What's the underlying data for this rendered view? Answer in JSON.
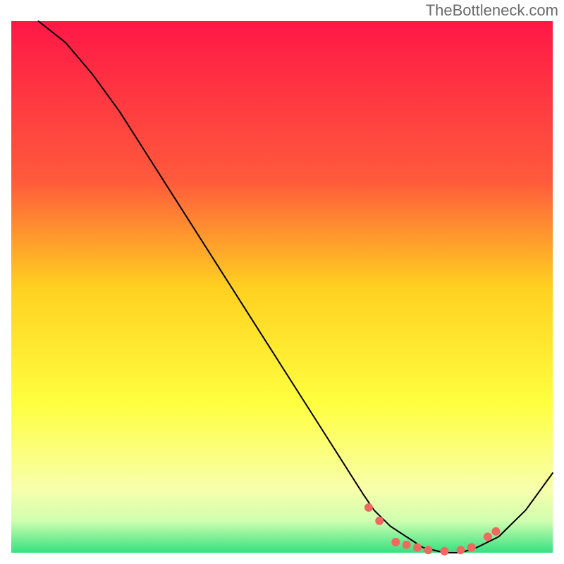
{
  "watermark": "TheBottleneck.com",
  "chart_data": {
    "type": "line",
    "title": "",
    "xlabel": "",
    "ylabel": "",
    "xlim": [
      0,
      100
    ],
    "ylim": [
      0,
      100
    ],
    "gradient": {
      "top": "#ff1846",
      "upper_mid": "#ff8040",
      "mid": "#ffd020",
      "lower_mid": "#ffff50",
      "bottom": "#35e080"
    },
    "series": [
      {
        "name": "curve",
        "color": "#000000",
        "stroke_width": 2,
        "x": [
          5,
          10,
          15,
          20,
          25,
          30,
          35,
          40,
          45,
          50,
          55,
          60,
          65,
          67,
          70,
          73,
          76,
          80,
          83,
          86,
          90,
          95,
          100
        ],
        "y": [
          100,
          96,
          90,
          83,
          75,
          67,
          59,
          51,
          43,
          35,
          27,
          19,
          11,
          8,
          5,
          3,
          1,
          0,
          0,
          1,
          3,
          8,
          15
        ]
      }
    ],
    "markers": {
      "color": "#ef6960",
      "radius": 6,
      "points": [
        {
          "x": 66,
          "y": 8.5
        },
        {
          "x": 68,
          "y": 6
        },
        {
          "x": 71,
          "y": 2
        },
        {
          "x": 73,
          "y": 1.5
        },
        {
          "x": 75,
          "y": 1
        },
        {
          "x": 77,
          "y": 0.5
        },
        {
          "x": 80,
          "y": 0.3
        },
        {
          "x": 83,
          "y": 0.5
        },
        {
          "x": 85,
          "y": 1
        },
        {
          "x": 88,
          "y": 3
        },
        {
          "x": 89.5,
          "y": 4
        }
      ]
    },
    "plot_area_fraction": 0.96
  }
}
